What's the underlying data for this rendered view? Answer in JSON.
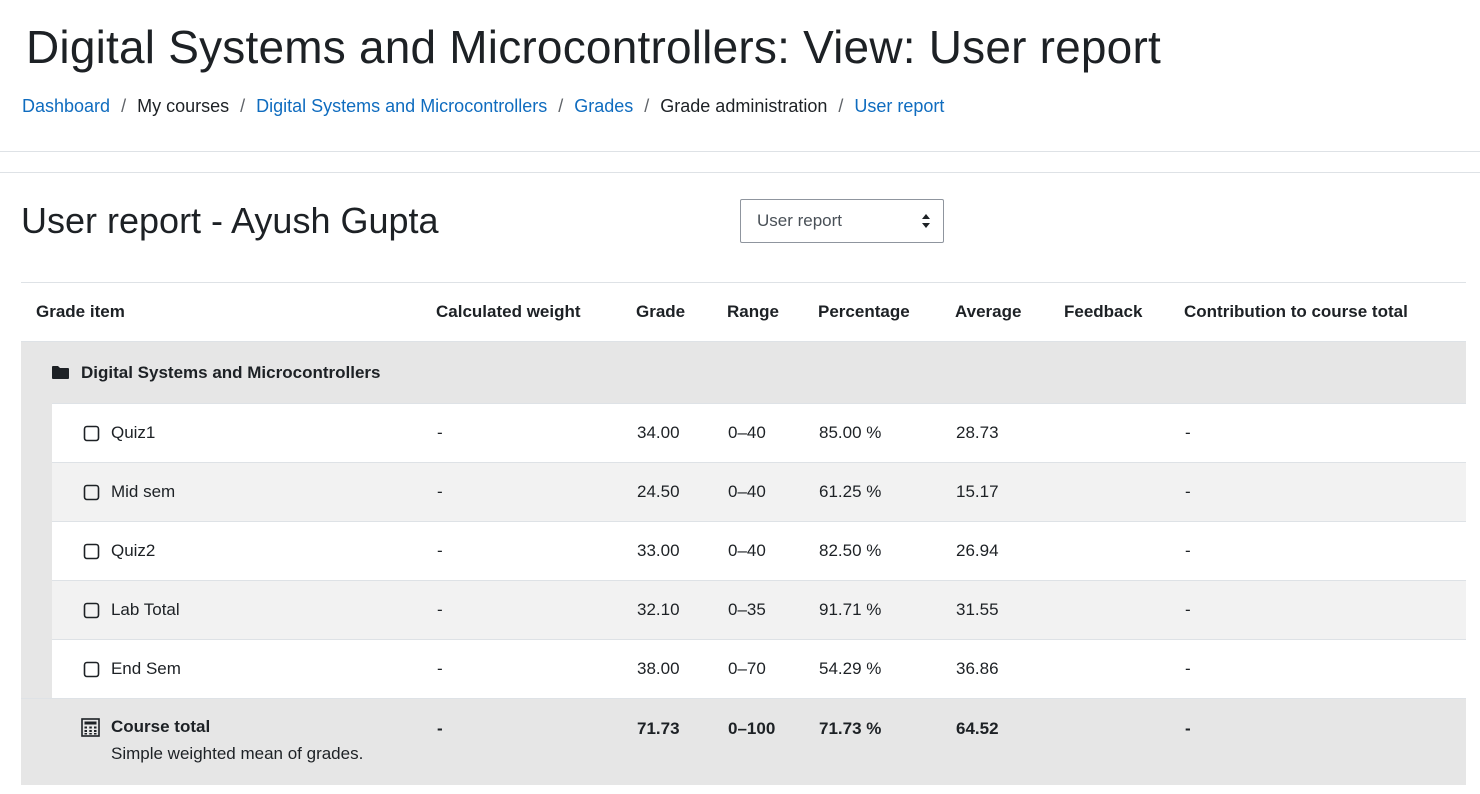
{
  "page": {
    "title": "Digital Systems and Microcontrollers: View: User report"
  },
  "breadcrumb": {
    "items": [
      {
        "label": "Dashboard",
        "link": true
      },
      {
        "label": "My courses",
        "link": false
      },
      {
        "label": "Digital Systems and Microcontrollers",
        "link": true
      },
      {
        "label": "Grades",
        "link": true
      },
      {
        "label": "Grade administration",
        "link": false
      },
      {
        "label": "User report",
        "link": true
      }
    ],
    "separator": "/"
  },
  "report": {
    "heading": "User report - Ayush Gupta",
    "selector": {
      "selected": "User report"
    }
  },
  "table": {
    "headers": [
      "Grade item",
      "Calculated weight",
      "Grade",
      "Range",
      "Percentage",
      "Average",
      "Feedback",
      "Contribution to course total"
    ],
    "category": "Digital Systems and Microcontrollers",
    "rows": [
      {
        "name": "Quiz1",
        "weight": "-",
        "grade": "34.00",
        "range": "0–40",
        "percentage": "85.00 %",
        "average": "28.73",
        "feedback": "",
        "contribution": "-"
      },
      {
        "name": "Mid sem",
        "weight": "-",
        "grade": "24.50",
        "range": "0–40",
        "percentage": "61.25 %",
        "average": "15.17",
        "feedback": "",
        "contribution": "-"
      },
      {
        "name": "Quiz2",
        "weight": "-",
        "grade": "33.00",
        "range": "0–40",
        "percentage": "82.50 %",
        "average": "26.94",
        "feedback": "",
        "contribution": "-"
      },
      {
        "name": "Lab Total",
        "weight": "-",
        "grade": "32.10",
        "range": "0–35",
        "percentage": "91.71 %",
        "average": "31.55",
        "feedback": "",
        "contribution": "-"
      },
      {
        "name": "End Sem",
        "weight": "-",
        "grade": "38.00",
        "range": "0–70",
        "percentage": "54.29 %",
        "average": "36.86",
        "feedback": "",
        "contribution": "-"
      }
    ],
    "total": {
      "name": "Course total",
      "subtitle": "Simple weighted mean of grades.",
      "weight": "-",
      "grade": "71.73",
      "range": "0–100",
      "percentage": "71.73 %",
      "average": "64.52",
      "feedback": "",
      "contribution": "-"
    }
  },
  "icons": {
    "category": "folder-icon",
    "item": "square-outline-icon",
    "total": "calculator-icon",
    "select": "sort-arrows-icon"
  },
  "colors": {
    "link": "#0f6cbf",
    "text": "#1d2125",
    "category_bg": "#e6e6e6",
    "stripe_bg": "#f2f2f2"
  }
}
